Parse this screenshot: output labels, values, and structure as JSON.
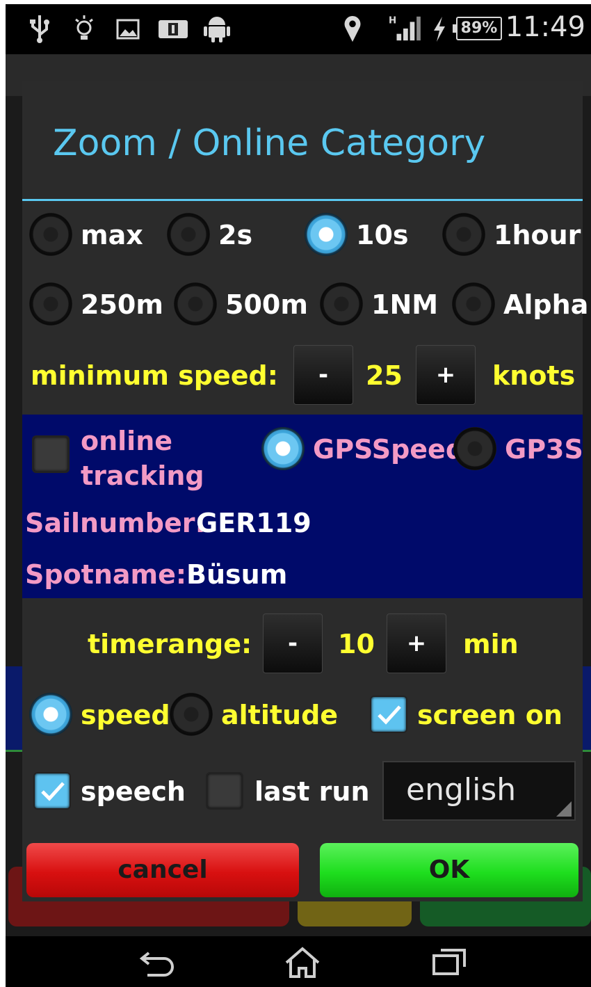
{
  "statusbar": {
    "battery": "89%",
    "time": "11:49",
    "icons": [
      "usb-icon",
      "lightbulb-icon",
      "image-icon",
      "notification-icon",
      "android-icon",
      "location-icon",
      "signal-icon",
      "charging-icon"
    ]
  },
  "dialog": {
    "title": "Zoom / Online Category",
    "zoom_row1": [
      {
        "label": "max",
        "selected": false
      },
      {
        "label": "2s",
        "selected": false
      },
      {
        "label": "10s",
        "selected": true
      },
      {
        "label": "1hour",
        "selected": false
      }
    ],
    "zoom_row2": [
      {
        "label": "250m",
        "selected": false
      },
      {
        "label": "500m",
        "selected": false
      },
      {
        "label": "1NM",
        "selected": false
      },
      {
        "label": "Alpha",
        "selected": false
      }
    ],
    "min_speed": {
      "label": "minimum speed:",
      "minus": "-",
      "value": "25",
      "plus": "+",
      "unit": "knots"
    },
    "online": {
      "tracking_label_line1": "online",
      "tracking_label_line2": "tracking",
      "tracking_checked": false,
      "gpsspeed_label": "GPSSpeed",
      "gpsspeed_selected": true,
      "gp3s_label": "GP3S",
      "gp3s_selected": false,
      "sailnumber_label": "Sailnumber:",
      "sailnumber_value": "GER119",
      "spotname_label": "Spotname:",
      "spotname_value": "Büsum"
    },
    "timerange": {
      "label": "timerange:",
      "minus": "-",
      "value": "10",
      "plus": "+",
      "unit": "min"
    },
    "mode": {
      "speed_label": "speed",
      "speed_selected": true,
      "altitude_label": "altitude",
      "altitude_selected": false,
      "screen_on_label": "screen on",
      "screen_on_checked": true
    },
    "bottom": {
      "speech_label": "speech",
      "speech_checked": true,
      "last_run_label": "last run",
      "last_run_checked": false,
      "language": "english"
    },
    "buttons": {
      "cancel": "cancel",
      "ok": "OK"
    }
  },
  "colors": {
    "accent": "#5ac8f0",
    "yellow": "#ffff30",
    "pink": "#f39ac5",
    "panel_blue": "#000a6a",
    "cancel": "#e01818",
    "ok": "#22e022"
  }
}
